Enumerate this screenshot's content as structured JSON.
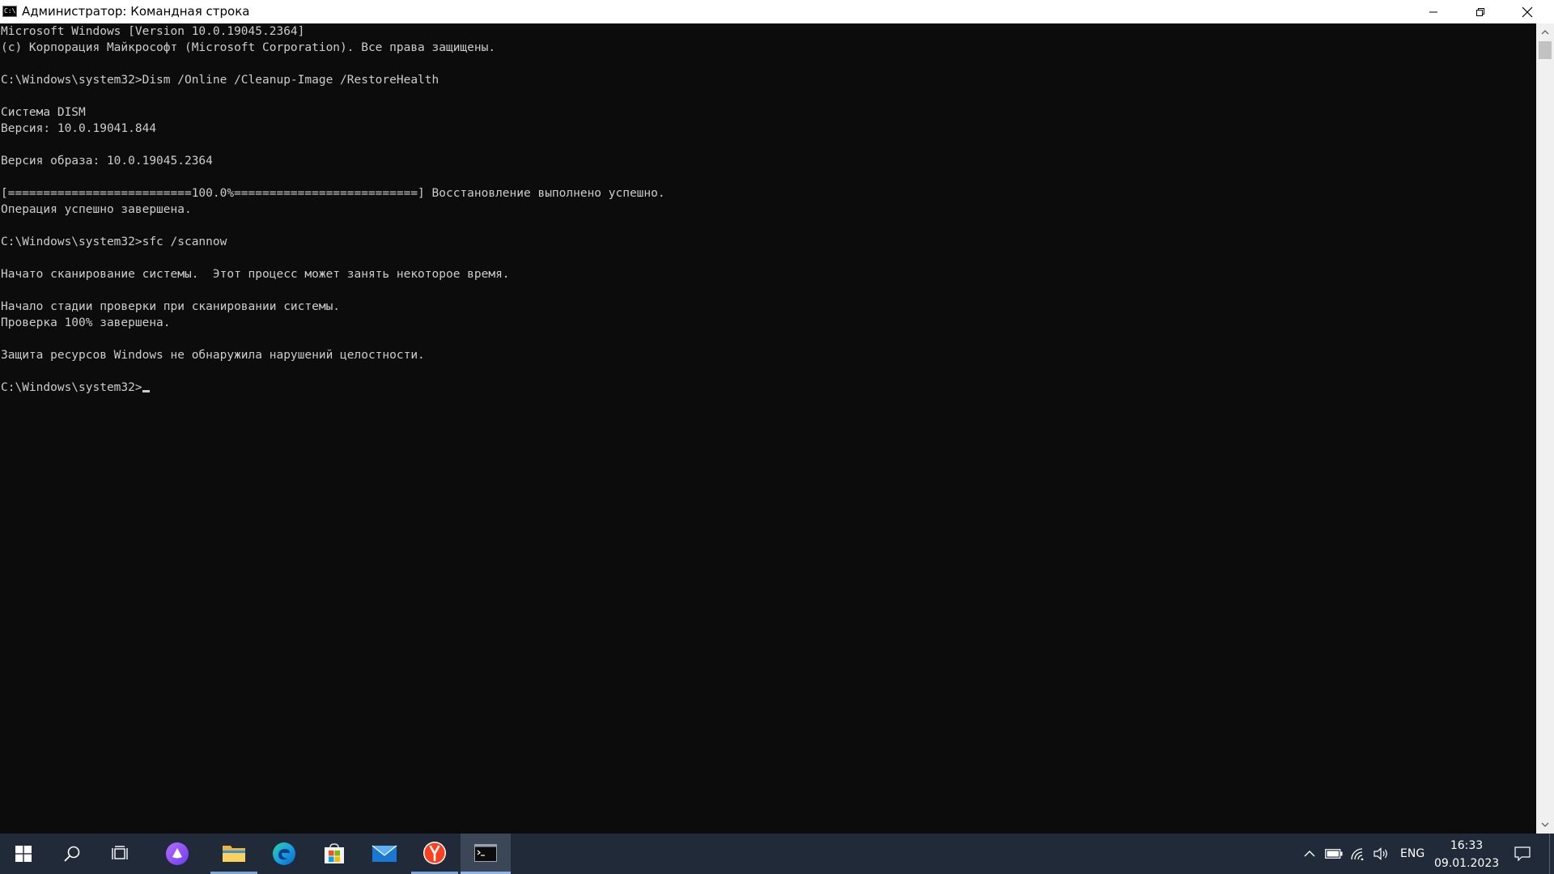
{
  "window": {
    "title": "Администратор: Командная строка",
    "icon_label": "C:\\"
  },
  "console": {
    "lines": [
      "Microsoft Windows [Version 10.0.19045.2364]",
      "(c) Корпорация Майкрософт (Microsoft Corporation). Все права защищены.",
      "",
      "C:\\Windows\\system32>Dism /Online /Cleanup-Image /RestoreHealth",
      "",
      "Cистема DISM",
      "Версия: 10.0.19041.844",
      "",
      "Версия образа: 10.0.19045.2364",
      "",
      "[==========================100.0%==========================] Восстановление выполнено успешно.",
      "Операция успешно завершена.",
      "",
      "C:\\Windows\\system32>sfc /scannow",
      "",
      "Начато сканирование системы.  Этот процесс может занять некоторое время.",
      "",
      "Начало стадии проверки при сканировании системы.",
      "Проверка 100% завершена.",
      "",
      "Защита ресурсов Windows не обнаружила нарушений целостности.",
      ""
    ],
    "prompt": "C:\\Windows\\system32>"
  },
  "taskbar": {
    "apps": [
      {
        "name": "start-button",
        "icon": "windows-logo-icon"
      },
      {
        "name": "search-button",
        "icon": "search-icon"
      },
      {
        "name": "task-view-button",
        "icon": "task-view-icon"
      },
      {
        "name": "alice-button",
        "icon": "alice-assistant-icon"
      },
      {
        "name": "file-explorer-button",
        "icon": "folder-icon"
      },
      {
        "name": "edge-button",
        "icon": "edge-icon"
      },
      {
        "name": "store-button",
        "icon": "store-icon"
      },
      {
        "name": "mail-button",
        "icon": "mail-icon"
      },
      {
        "name": "yandex-browser-button",
        "icon": "yandex-icon"
      },
      {
        "name": "cmd-button",
        "icon": "cmd-icon"
      }
    ],
    "tray": {
      "language": "ENG",
      "time": "16:33",
      "date": "09.01.2023"
    }
  },
  "colors": {
    "console_bg": "#0c0c0c",
    "console_text": "#cccccc",
    "taskbar_bg": "#202a38",
    "titlebar_bg": "#ffffff"
  }
}
